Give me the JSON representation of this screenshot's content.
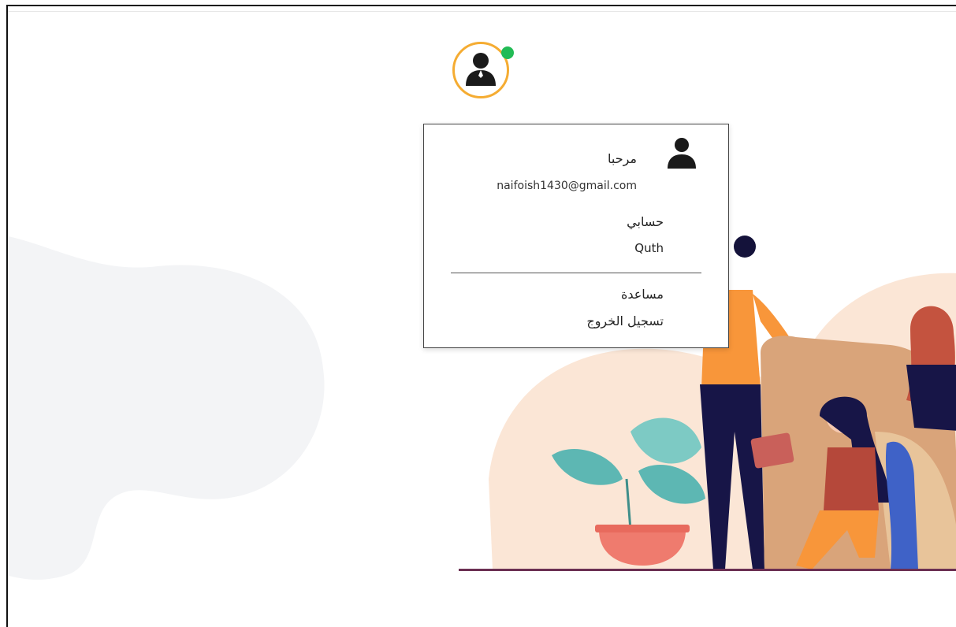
{
  "user_menu": {
    "greeting": "مرحبا",
    "email": "naifoish1430@gmail.com",
    "account_title": "حسابي",
    "account_name": "Quth",
    "help_label": "مساعدة",
    "logout_label": "تسجيل الخروج"
  },
  "colors": {
    "avatar_ring": "#f5ac32",
    "online_status": "#22bb55",
    "blob_background": "#f3f4f6",
    "illustration_peach": "#fbe6d6"
  },
  "icons": {
    "avatar": "user-icon",
    "status": "online-status-dot"
  }
}
